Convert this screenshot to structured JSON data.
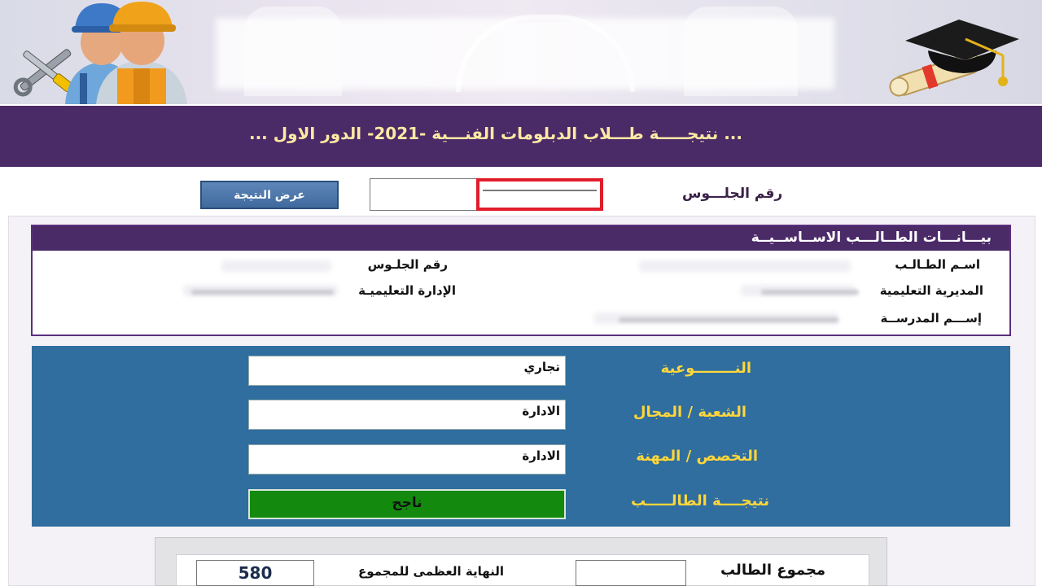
{
  "header": {
    "title": "... نتيجـــــة طـــلاب الدبلومات الفنـــية -2021- الدور الاول ..."
  },
  "search": {
    "seat_label": "رقم الجلـــوس",
    "seat_value": "",
    "button_label": "عرض النتيجة"
  },
  "basic_data": {
    "title": "بيـــانـــات الطــالـــب الاســاســيــة",
    "student_name_label": "اسـم الطـالـب",
    "seat_number_label": "رقم الجلـوس",
    "directorate_label": "المديرية التعليمية",
    "administration_label": "الإدارة التعليميـة",
    "school_label": "إســـم المدرســة"
  },
  "details": {
    "type_label": "النــــــــوعية",
    "type_value": "تجاري",
    "division_label": "الشعبة / المجال",
    "division_value": "الادارة",
    "specialization_label": "التخصص / المهنة",
    "specialization_value": "الادارة",
    "result_label": "نتيجــــة الطالـــــب",
    "result_value": "ناجح"
  },
  "totals": {
    "student_total_label": "مجموع الطالب",
    "student_total_value": "",
    "max_total_label": "النهاية العظمى للمجموع",
    "max_total_value": "580"
  },
  "colors": {
    "title_bar": "#4b2a68",
    "title_text": "#ffe9a3",
    "details_bg": "#2f6e9f",
    "details_labels": "#ffd63a",
    "result_success": "#138a0e",
    "highlight_red": "#e21c2a"
  }
}
